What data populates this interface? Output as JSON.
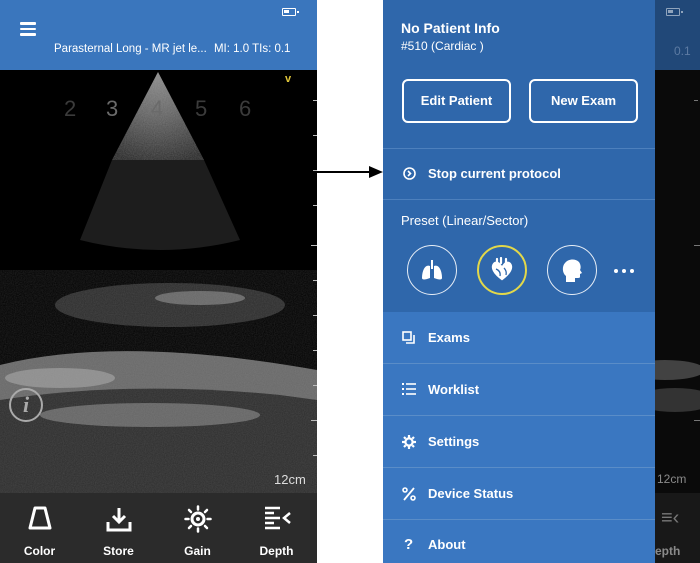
{
  "left_screen": {
    "header": {
      "mode_label": "Parasternal Long - MR jet le...",
      "indices": "MI: 1.0  TIs: 0.1"
    },
    "depth_markers": [
      "2",
      "3",
      "4",
      "5",
      "6"
    ],
    "focus_marker": "v",
    "depth_readout": "12cm",
    "toolbar": [
      {
        "label": "Color",
        "icon": "probe-icon"
      },
      {
        "label": "Store",
        "icon": "download-icon"
      },
      {
        "label": "Gain",
        "icon": "gain-icon"
      },
      {
        "label": "Depth",
        "icon": "depth-icon"
      }
    ]
  },
  "right_screen": {
    "drawer": {
      "patient_title": "No Patient Info",
      "exam_id": "#510 (Cardiac )",
      "edit_patient_label": "Edit Patient",
      "new_exam_label": "New Exam",
      "protocol_label": "Stop current protocol",
      "preset_label": "Preset (Linear/Sector)",
      "presets": [
        {
          "icon": "lungs-icon",
          "selected": false
        },
        {
          "icon": "heart-icon",
          "selected": true
        },
        {
          "icon": "head-icon",
          "selected": false
        }
      ],
      "menu": [
        {
          "label": "Exams",
          "icon": "exams-icon"
        },
        {
          "label": "Worklist",
          "icon": "list-icon"
        },
        {
          "label": "Settings",
          "icon": "gear-icon"
        },
        {
          "label": "Device Status",
          "icon": "percent-icon"
        },
        {
          "label": "About",
          "icon": "question-icon"
        }
      ]
    },
    "peek": {
      "header_text": "0.1",
      "depth_text": "12cm",
      "toolbar_text": "epth"
    }
  },
  "colors": {
    "header_blue": "#3a76bd",
    "drawer_blue": "#2f67ab",
    "menu_blue": "#3a77c1",
    "selected_ring": "#e2d84a",
    "toolbar_gray": "#2b2b2b"
  }
}
